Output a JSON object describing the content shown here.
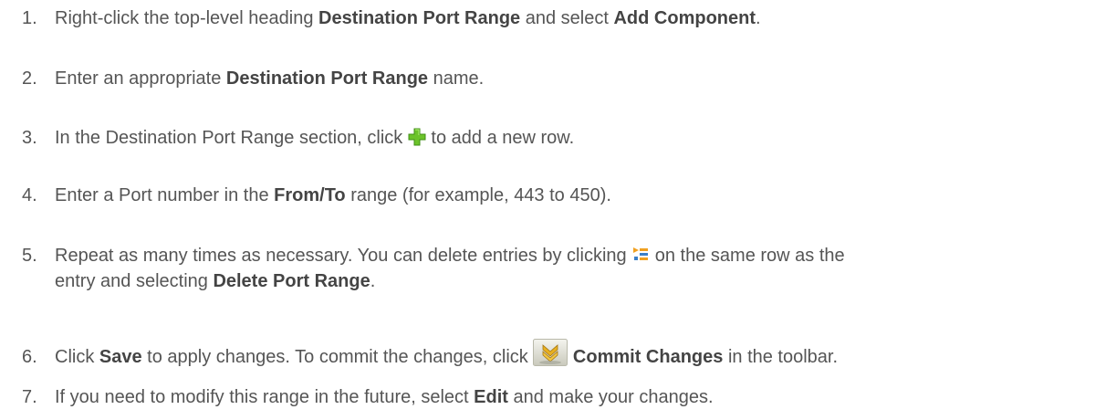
{
  "steps": [
    {
      "num": "1.",
      "t1": "Right-click the top-level heading ",
      "b1": "Destination Port Range",
      "t2": " and select ",
      "b2": "Add Component",
      "t3": "."
    },
    {
      "num": "2.",
      "t1": "Enter an appropriate ",
      "b1": "Destination Port Range",
      "t2": " name."
    },
    {
      "num": "3.",
      "t1": "In the Destination Port Range section, click ",
      "icon": "green-plus-icon",
      "t2": " to add a new row."
    },
    {
      "num": "4.",
      "t1": "Enter a Port number in the ",
      "b1": "From/To",
      "t2": " range (for example, 443 to 450)."
    },
    {
      "num": "5.",
      "t1": "Repeat as many times as necessary. You can delete entries by clicking ",
      "icon": "row-actions-menu-icon",
      "t2": " on the same row as the",
      "t3": "entry and selecting ",
      "b1": "Delete Port Range",
      "t4": "."
    },
    {
      "num": "6.",
      "t1": "Click ",
      "b1": "Save",
      "t2": " to apply changes. To commit the changes, click ",
      "icon": "commit-changes-icon",
      "b2": "Commit Changes",
      "t3": " in the toolbar."
    },
    {
      "num": "7.",
      "t1": "If you need to modify this range in the future, select ",
      "b1": "Edit",
      "t2": " and make your changes."
    }
  ],
  "colors": {
    "text": "#555555",
    "bold": "#444444",
    "plus_green": "#6cc32a",
    "menu_orange": "#f0a020",
    "menu_blue": "#3a7fc9"
  }
}
